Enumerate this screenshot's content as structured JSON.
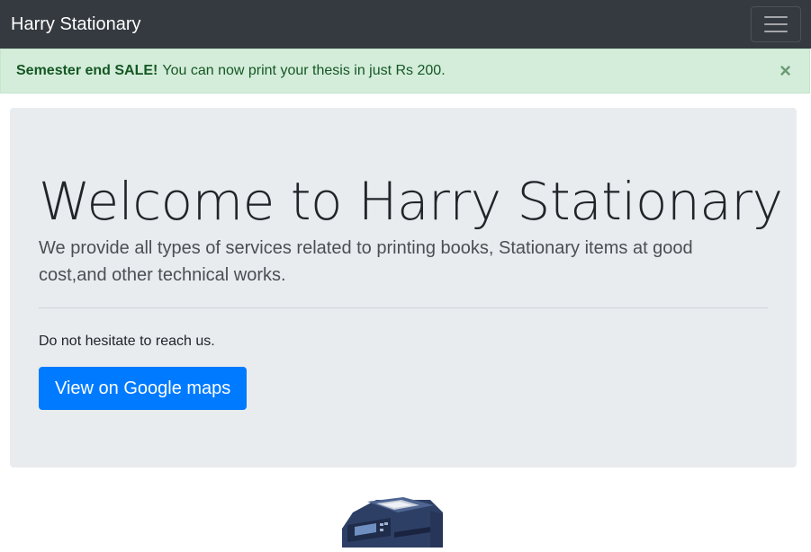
{
  "navbar": {
    "brand": "Harry Stationary",
    "toggler_icon": "hamburger-icon"
  },
  "alert": {
    "strong": "Semester end SALE!",
    "message": "You can now print your thesis in just Rs 200.",
    "close_glyph": "×"
  },
  "jumbotron": {
    "title": "Welcome to Harry Stationary",
    "lead": "We provide all types of services related to printing books, Stationary items at good cost,and other technical works.",
    "note": "Do not hesitate to reach us.",
    "button_label": "View on Google maps"
  },
  "product": {
    "icon": "printer-icon"
  },
  "colors": {
    "navbar": "#343a40",
    "alert_bg": "#d4edda",
    "alert_text": "#155724",
    "jumbotron_bg": "#e9ecef",
    "primary": "#007bff"
  }
}
